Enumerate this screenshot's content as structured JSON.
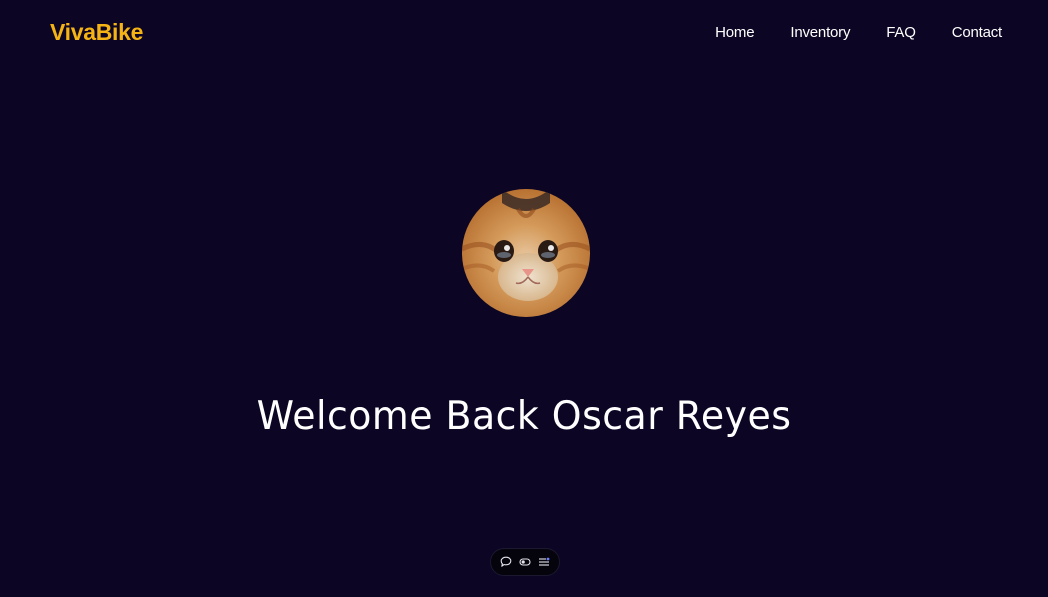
{
  "header": {
    "brand": "VivaBike",
    "nav": [
      {
        "label": "Home"
      },
      {
        "label": "Inventory"
      },
      {
        "label": "FAQ"
      },
      {
        "label": "Contact"
      }
    ]
  },
  "main": {
    "avatar_icon": "cat-avatar",
    "welcome": "Welcome Back Oscar Reyes"
  },
  "toolbar": {
    "icons": [
      "comment-icon",
      "toggle-icon",
      "list-settings-icon"
    ]
  },
  "colors": {
    "background": "#0c0624",
    "brand": "#f5b414",
    "text": "#ffffff"
  }
}
